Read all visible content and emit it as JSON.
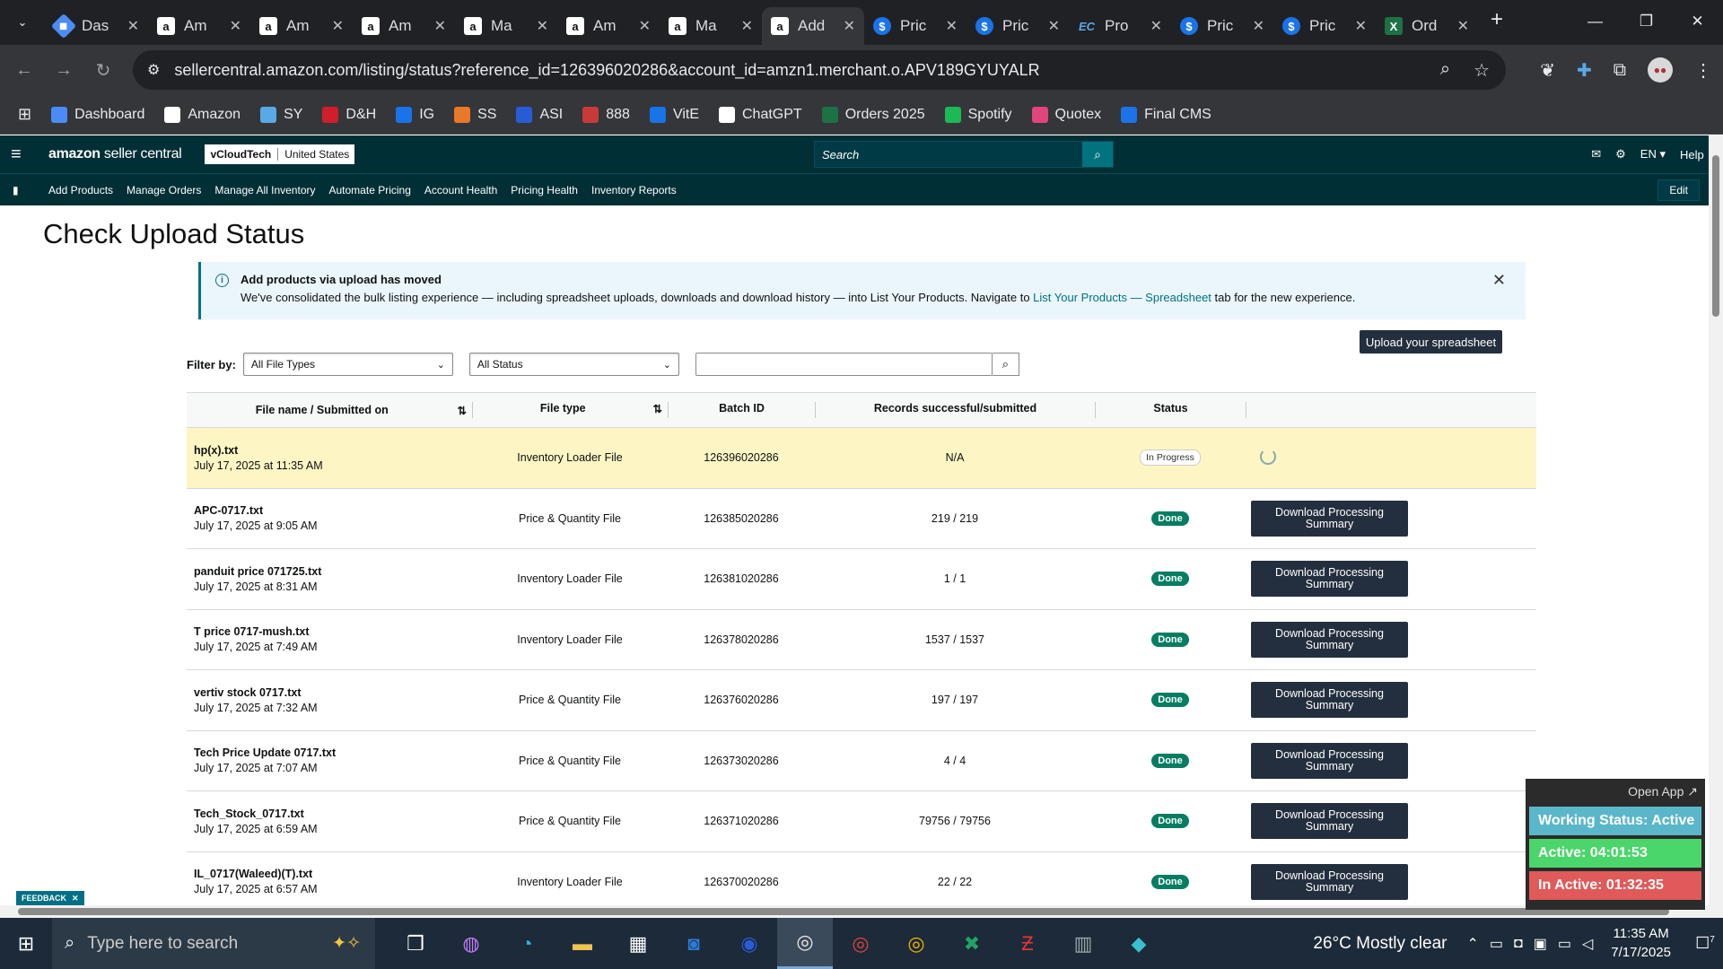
{
  "browser": {
    "tabs": [
      {
        "title": "Das",
        "icon": "diamond-icon"
      },
      {
        "title": "Am",
        "icon": "amazon-icon"
      },
      {
        "title": "Am",
        "icon": "amazon-icon"
      },
      {
        "title": "Am",
        "icon": "amazon-icon"
      },
      {
        "title": "Ma",
        "icon": "amazon-icon"
      },
      {
        "title": "Am",
        "icon": "amazon-icon"
      },
      {
        "title": "Ma",
        "icon": "amazon-icon"
      },
      {
        "title": "Add",
        "icon": "amazon-icon",
        "active": true
      },
      {
        "title": "Pric",
        "icon": "dollar-icon"
      },
      {
        "title": "Pric",
        "icon": "dollar-icon"
      },
      {
        "title": "Pro",
        "icon": "ec-icon"
      },
      {
        "title": "Pric",
        "icon": "dollar-icon"
      },
      {
        "title": "Pric",
        "icon": "dollar-icon"
      },
      {
        "title": "Ord",
        "icon": "excel-icon"
      }
    ],
    "url": "sellercentral.amazon.com/listing/status?reference_id=126396020286&account_id=amzn1.merchant.o.APV189GYUYALR",
    "bookmarks": [
      {
        "label": "Dashboard",
        "color": "#4c8bf5"
      },
      {
        "label": "Amazon",
        "color": "#ffffff"
      },
      {
        "label": "SY",
        "color": "#5aa9e6"
      },
      {
        "label": "D&H",
        "color": "#d01e2a"
      },
      {
        "label": "IG",
        "color": "#1a73e8"
      },
      {
        "label": "SS",
        "color": "#e8782a"
      },
      {
        "label": "ASI",
        "color": "#2a5bd7"
      },
      {
        "label": "888",
        "color": "#c83a3a"
      },
      {
        "label": "VitE",
        "color": "#1a73e8"
      },
      {
        "label": "ChatGPT",
        "color": "#ffffff"
      },
      {
        "label": "Orders 2025",
        "color": "#1e7145"
      },
      {
        "label": "Spotify",
        "color": "#1db954"
      },
      {
        "label": "Quotex",
        "color": "#e0457b"
      },
      {
        "label": "Final CMS",
        "color": "#1a73e8"
      }
    ]
  },
  "header": {
    "logo_bold": "amazon",
    "logo_rest": " seller central",
    "store_name": "vCloudTech",
    "store_region": "United States",
    "search_placeholder": "Search",
    "lang": "EN",
    "help": "Help"
  },
  "nav": {
    "items": [
      "Add Products",
      "Manage Orders",
      "Manage All Inventory",
      "Automate Pricing",
      "Account Health",
      "Pricing Health",
      "Inventory Reports"
    ],
    "edit": "Edit"
  },
  "page": {
    "title": "Check Upload Status",
    "banner_title": "Add products via upload has moved",
    "banner_body_pre": "We've consolidated the bulk listing experience — including spreadsheet uploads, downloads and download history — into List Your Products. Navigate to ",
    "banner_link": "List Your Products — Spreadsheet",
    "banner_body_post": " tab for the new experience.",
    "upload_button": "Upload your spreadsheet",
    "filter_label": "Filter by:",
    "filter_type": "All File Types",
    "filter_status": "All Status"
  },
  "table": {
    "headers": [
      "File name / Submitted on",
      "File type",
      "Batch ID",
      "Records successful/submitted",
      "Status"
    ],
    "download_label": "Download Processing Summary",
    "rows": [
      {
        "name": "hp(x).txt",
        "date": "July 17, 2025 at 11:35 AM",
        "type": "Inventory Loader File",
        "batch": "126396020286",
        "records": "N/A",
        "status": "In Progress"
      },
      {
        "name": "APC-0717.txt",
        "date": "July 17, 2025 at 9:05 AM",
        "type": "Price & Quantity File",
        "batch": "126385020286",
        "records": "219 / 219",
        "status": "Done"
      },
      {
        "name": "panduit price 071725.txt",
        "date": "July 17, 2025 at 8:31 AM",
        "type": "Inventory Loader File",
        "batch": "126381020286",
        "records": "1 / 1",
        "status": "Done"
      },
      {
        "name": "T price 0717-mush.txt",
        "date": "July 17, 2025 at 7:49 AM",
        "type": "Inventory Loader File",
        "batch": "126378020286",
        "records": "1537 / 1537",
        "status": "Done"
      },
      {
        "name": "vertiv stock 0717.txt",
        "date": "July 17, 2025 at 7:32 AM",
        "type": "Price & Quantity File",
        "batch": "126376020286",
        "records": "197 / 197",
        "status": "Done"
      },
      {
        "name": "Tech Price Update 0717.txt",
        "date": "July 17, 2025 at 7:07 AM",
        "type": "Price & Quantity File",
        "batch": "126373020286",
        "records": "4 / 4",
        "status": "Done"
      },
      {
        "name": "Tech_Stock_0717.txt",
        "date": "July 17, 2025 at 6:59 AM",
        "type": "Price & Quantity File",
        "batch": "126371020286",
        "records": "79756 / 79756",
        "status": "Done"
      },
      {
        "name": "IL_0717(Waleed)(T).txt",
        "date": "July 17, 2025 at 6:57 AM",
        "type": "Inventory Loader File",
        "batch": "126370020286",
        "records": "22 / 22",
        "status": "Done"
      }
    ]
  },
  "feedback": "FEEDBACK",
  "widget": {
    "open_app": "Open App ↗",
    "working": "Working Status: Active",
    "active": "Active: 04:01:53",
    "inactive": "In Active: 01:32:35"
  },
  "taskbar": {
    "search_placeholder": "Type here to search",
    "weather": "26°C  Mostly clear",
    "time": "11:35 AM",
    "date": "7/17/2025",
    "notif_count": "7"
  }
}
